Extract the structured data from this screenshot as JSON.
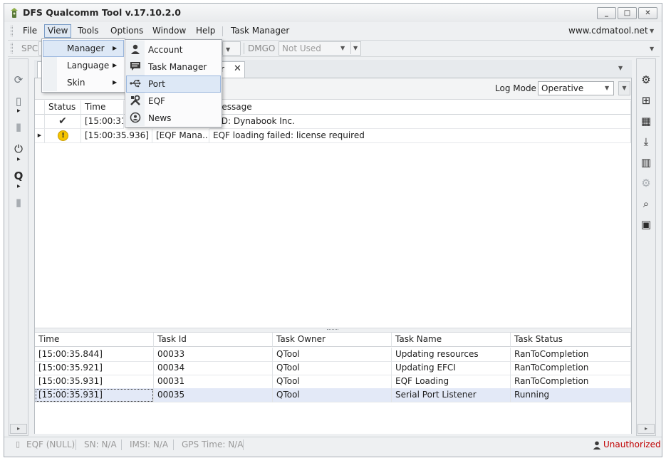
{
  "window": {
    "title": "DFS Qualcomm Tool v.17.10.2.0",
    "buttons": {
      "minimize": "_",
      "maximize": "□",
      "close": "✕"
    }
  },
  "menubar": {
    "items": [
      "File",
      "View",
      "Tools",
      "Options",
      "Window",
      "Help",
      "Task Manager"
    ],
    "website": "www.cdmatool.net"
  },
  "toolbar": {
    "spc_label": "SPC",
    "dmgo_label": "DMGO",
    "dmgo_value": "Not Used"
  },
  "view_menu": {
    "items": [
      {
        "label": "Manager",
        "has_submenu": true
      },
      {
        "label": "Language",
        "has_submenu": true
      },
      {
        "label": "Skin",
        "has_submenu": true
      }
    ]
  },
  "manager_submenu": {
    "items": [
      {
        "label": "Account",
        "icon": "user-icon"
      },
      {
        "label": "Task Manager",
        "icon": "chat-icon"
      },
      {
        "label": "Port",
        "icon": "usb-icon"
      },
      {
        "label": "EQF",
        "icon": "tools-icon"
      },
      {
        "label": "News",
        "icon": "news-icon"
      }
    ]
  },
  "tab": {
    "label_fragment": "r",
    "close": "✕"
  },
  "log_toolbar": {
    "log_mode_label": "Log Mode",
    "log_mode_value": "Operative"
  },
  "log_grid": {
    "columns": [
      "Status",
      "Time",
      "",
      "Message"
    ],
    "rows": [
      {
        "status": "ok",
        "time": "[15:00:31",
        "source": "",
        "message": "VID: Dynabook Inc."
      },
      {
        "status": "warn",
        "time": "[15:00:35.936]",
        "source": "[EQF Mana...",
        "message": "EQF loading failed: license required"
      }
    ]
  },
  "task_grid": {
    "columns": [
      "Time",
      "Task Id",
      "Task Owner",
      "Task Name",
      "Task Status"
    ],
    "rows": [
      [
        "[15:00:35.844]",
        "00033",
        "QTool",
        "Updating resources",
        "RanToCompletion"
      ],
      [
        "[15:00:35.921]",
        "00034",
        "QTool",
        "Updating EFCI",
        "RanToCompletion"
      ],
      [
        "[15:00:35.931]",
        "00031",
        "QTool",
        "EQF Loading",
        "RanToCompletion"
      ],
      [
        "[15:00:35.931]",
        "00035",
        "QTool",
        "Serial Port Listener",
        "Running"
      ]
    ]
  },
  "statusbar": {
    "eqf": "EQF (NULL)",
    "sn": "SN: N/A",
    "imsi": "IMSI: N/A",
    "gps": "GPS Time: N/A",
    "auth": "Unauthorized"
  },
  "colors": {
    "accent": "#7a9cc6",
    "error": "#c00000",
    "warning": "#f5c400"
  }
}
